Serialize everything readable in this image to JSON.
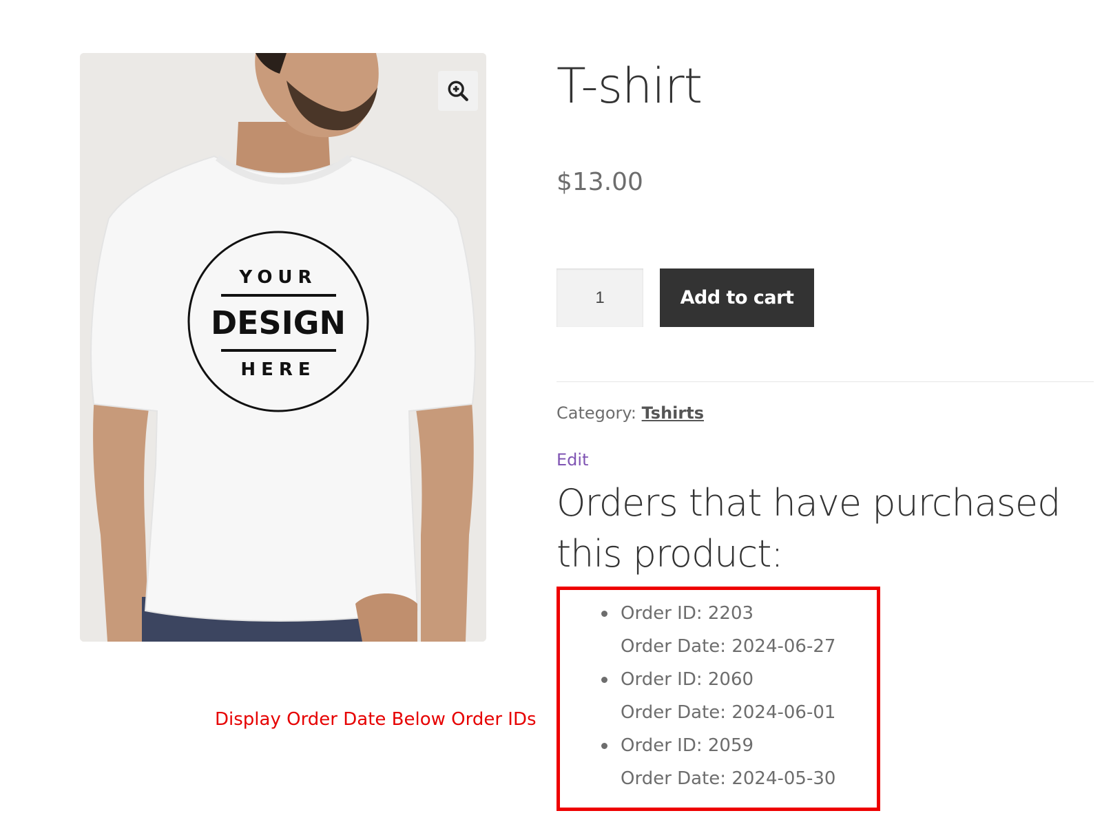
{
  "product": {
    "title": "T-shirt",
    "price": "$13.00",
    "quantity": "1",
    "add_to_cart_label": "Add to cart",
    "category_label": "Category:",
    "category_name": "Tshirts",
    "edit_label": "Edit"
  },
  "image": {
    "print_top": "YOUR",
    "print_middle": "DESIGN",
    "print_bottom": "HERE",
    "zoom_icon": "zoom-in-icon"
  },
  "orders": {
    "heading": "Orders that have purchased this product:",
    "items": [
      {
        "id_text": "Order ID: 2203",
        "date_text": "Order Date: 2024-06-27"
      },
      {
        "id_text": "Order ID: 2060",
        "date_text": "Order Date: 2024-06-01"
      },
      {
        "id_text": "Order ID: 2059",
        "date_text": "Order Date: 2024-05-30"
      }
    ]
  },
  "annotation": {
    "text": "Display Order Date Below Order IDs",
    "color": "#e60000",
    "box_color": "#ee0000"
  },
  "colors": {
    "button_bg": "#333333",
    "edit_link": "#7f54b3",
    "text_muted": "#6d6d6d"
  }
}
